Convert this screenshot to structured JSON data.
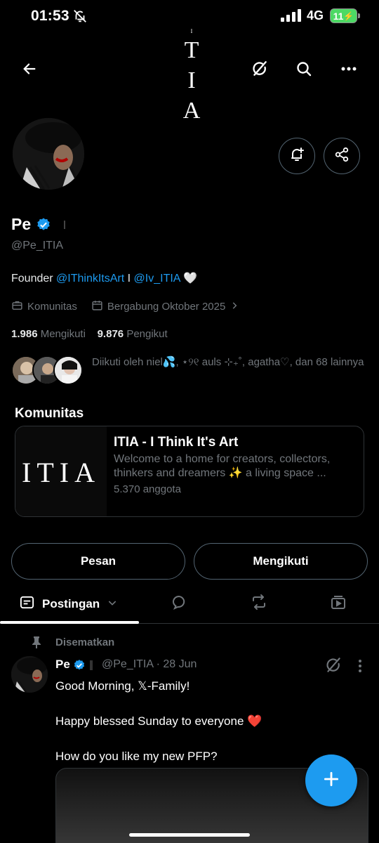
{
  "status_bar": {
    "time": "01:53",
    "network": "4G",
    "battery": "11"
  },
  "header": {
    "logo_letters": [
      "I",
      "T",
      "I",
      "A"
    ]
  },
  "profile": {
    "name": "Pe",
    "handle": "@Pe_ITIA",
    "bio_prefix": "Founder ",
    "bio_link1": "@IThinkItsArt",
    "bio_sep": " I ",
    "bio_link2": "@Iv_ITIA",
    "bio_suffix": " 🤍",
    "community_label": "Komunitas",
    "joined": "Bergabung Oktober 2025",
    "following_count": "1.986",
    "following_label": "Mengikuti",
    "followers_count": "9.876",
    "followers_label": "Pengikut",
    "followed_by": "Diikuti oleh niel💦, ⋆୨୧ auls ⊹₊˚, agatha♡, dan 68 lainnya"
  },
  "community": {
    "section_title": "Komunitas",
    "logo": "ITIA",
    "name": "ITIA - I Think It's Art",
    "description": "Welcome to a home for creators, collectors, thinkers and dreamers ✨ a living space ...",
    "members": "5.370 anggota"
  },
  "actions": {
    "message": "Pesan",
    "following": "Mengikuti"
  },
  "tabs": {
    "posts": "Postingan"
  },
  "post": {
    "pinned_label": "Disematkan",
    "author": "Pe",
    "handle_date": "@Pe_ITIA · 28 Jun",
    "line1": "Good Morning, 𝕏-Family!",
    "line2": "Happy blessed Sunday to everyone ❤️",
    "line3": "How do you like my new PFP?"
  },
  "colors": {
    "accent": "#1d9bf0",
    "muted": "#71767b",
    "border": "#2f3336"
  }
}
